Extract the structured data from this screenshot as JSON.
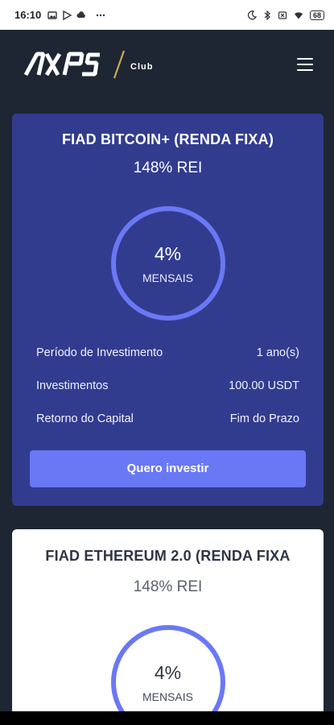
{
  "status_bar": {
    "time": "16:10",
    "battery": "68",
    "icons": [
      "gallery-icon",
      "play-icon",
      "cloud-icon",
      "more-dots-icon",
      "moon-icon",
      "bluetooth-icon",
      "sim-icon",
      "wifi-icon",
      "battery-icon"
    ]
  },
  "header": {
    "logo_text": "AXPS",
    "logo_sub": "Club",
    "menu_icon": "hamburger-icon"
  },
  "plans": [
    {
      "title": "FIAD BITCOIN+ (RENDA FIXA)",
      "rate": "148% REI",
      "ring_value": "4%",
      "ring_label": "MENSAIS",
      "details": [
        {
          "label": "Período de Investimento",
          "value": "1 ano(s)"
        },
        {
          "label": "Investimentos",
          "value": "100.00 USDT"
        },
        {
          "label": "Retorno do Capital",
          "value": "Fim do Prazo"
        }
      ],
      "button": "Quero investir"
    },
    {
      "title": "FIAD ETHEREUM 2.0 (RENDA FIXA",
      "rate": "148% REI",
      "ring_value": "4%",
      "ring_label": "MENSAIS"
    }
  ],
  "colors": {
    "background": "#1e2633",
    "card_primary": "#323c8f",
    "accent": "#6978f4",
    "card_secondary": "#ffffff"
  }
}
